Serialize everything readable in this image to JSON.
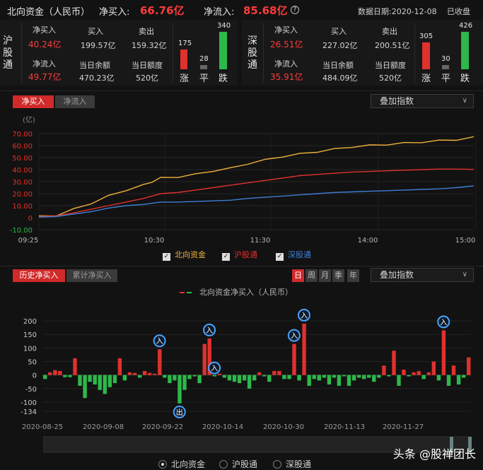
{
  "header": {
    "title": "北向资金（人民币）",
    "net_buy_label": "净买入:",
    "net_buy_value": "66.76亿",
    "net_inflow_label": "净流入:",
    "net_inflow_value": "85.68亿",
    "help_icon": "?",
    "date_label": "数据日期:2020-12-08",
    "status": "已收盘"
  },
  "sh": {
    "label_chars": [
      "沪",
      "股",
      "通"
    ],
    "net_buy_label": "净买入",
    "net_buy": "40.24亿",
    "buy_label": "买入",
    "buy": "199.57亿",
    "sell_label": "卖出",
    "sell": "159.32亿",
    "net_inflow_label": "净流入",
    "net_inflow": "49.77亿",
    "balance_label": "当日余额",
    "balance": "470.23亿",
    "quota_label": "当日额度",
    "quota": "520亿",
    "up": "175",
    "flat": "28",
    "down": "340",
    "up_char": "涨",
    "flat_char": "平",
    "down_char": "跌"
  },
  "sz": {
    "label_chars": [
      "深",
      "股",
      "通"
    ],
    "net_buy_label": "净买入",
    "net_buy": "26.51亿",
    "buy_label": "买入",
    "buy": "227.02亿",
    "sell_label": "卖出",
    "sell": "200.51亿",
    "net_inflow_label": "净流入",
    "net_inflow": "35.91亿",
    "balance_label": "当日余额",
    "balance": "484.09亿",
    "quota_label": "当日额度",
    "quota": "520亿",
    "up": "305",
    "flat": "30",
    "down": "426",
    "up_char": "涨",
    "flat_char": "平",
    "down_char": "跌"
  },
  "intraday": {
    "tab_net_buy": "净买入",
    "tab_net_inflow": "净流入",
    "overlay": "叠加指数",
    "legend": [
      "北向资金",
      "沪股通",
      "深股通"
    ],
    "colors": {
      "north": "#f0b13b",
      "sh": "#e0312d",
      "sz": "#3d7fd6"
    }
  },
  "history": {
    "tab_history": "历史净买入",
    "tab_cumulative": "累计净买入",
    "periods": [
      "日",
      "周",
      "月",
      "季",
      "年"
    ],
    "overlay": "叠加指数",
    "legend_label": "北向资金净买入（人民币）",
    "badge_in": "入",
    "badge_out": "出",
    "radios": [
      "北向资金",
      "沪股通",
      "深股通"
    ]
  },
  "watermark": "头条 @股禅团长",
  "chart_data": [
    {
      "type": "line",
      "unit_label": "(亿)",
      "yticks": [
        "70.00",
        "60.00",
        "50.00",
        "40.00",
        "30.00",
        "20.00",
        "10.00",
        "0",
        "-10.00"
      ],
      "ylim": [
        -10,
        70
      ],
      "xlabels": [
        "09:25",
        "10:30",
        "11:30",
        "14:00",
        "15:00"
      ],
      "x": [
        0,
        10,
        20,
        30,
        40,
        50,
        60,
        65,
        70,
        80,
        90,
        100,
        110,
        120,
        130,
        140,
        150,
        160,
        170,
        180,
        190,
        200,
        210,
        220,
        230,
        240,
        250
      ],
      "series": [
        {
          "name": "北向资金",
          "values": [
            1,
            2,
            7,
            12,
            18,
            23,
            27,
            30,
            33,
            34,
            36,
            39,
            41,
            45,
            48,
            51,
            53,
            55,
            57,
            59,
            60,
            61,
            62,
            63,
            64,
            65,
            66.8
          ]
        },
        {
          "name": "沪股通",
          "values": [
            1,
            1.5,
            4,
            7,
            10,
            13,
            16,
            18,
            20,
            21,
            23,
            25,
            27,
            29,
            31,
            33,
            35,
            36,
            37,
            38,
            38.5,
            39,
            39.5,
            40,
            40.5,
            40.5,
            40.2
          ]
        },
        {
          "name": "深股通",
          "values": [
            0.5,
            1,
            3,
            5,
            8,
            10,
            11,
            12,
            13,
            13,
            13.5,
            14,
            14.5,
            16,
            17,
            18,
            19,
            20,
            21,
            21.5,
            22,
            22.5,
            23,
            23.5,
            24,
            25,
            26.5
          ]
        }
      ]
    },
    {
      "type": "bar",
      "yticks": [
        "200",
        "150",
        "100",
        "50",
        "0",
        "-50",
        "-100",
        "-134"
      ],
      "ylim": [
        -134,
        200
      ],
      "xlabels": [
        "2020-08-25",
        "2020-09-08",
        "2020-09-22",
        "2020-10-14",
        "2020-10-30",
        "2020-11-13",
        "2020-11-27"
      ],
      "values": [
        -15,
        10,
        18,
        15,
        -8,
        -8,
        62,
        -40,
        -85,
        -25,
        -35,
        -55,
        -70,
        -45,
        -30,
        62,
        -20,
        10,
        8,
        -10,
        15,
        8,
        5,
        95,
        -10,
        -30,
        -20,
        -105,
        -55,
        -15,
        -5,
        -30,
        115,
        135,
        -5,
        5,
        -10,
        -20,
        -25,
        -30,
        -20,
        -50,
        -20,
        10,
        -5,
        -25,
        15,
        15,
        -15,
        -15,
        115,
        -20,
        190,
        -40,
        -15,
        -20,
        -10,
        -35,
        -10,
        -40,
        -5,
        -40,
        -20,
        -10,
        -15,
        -10,
        -25,
        -10,
        35,
        -5,
        90,
        -40,
        20,
        -5,
        10,
        15,
        -15,
        10,
        50,
        -20,
        165,
        -40,
        35,
        -35,
        -10,
        65
      ],
      "in_markers": [
        23,
        33,
        34,
        50,
        52,
        80
      ],
      "out_markers": [
        27
      ]
    }
  ]
}
